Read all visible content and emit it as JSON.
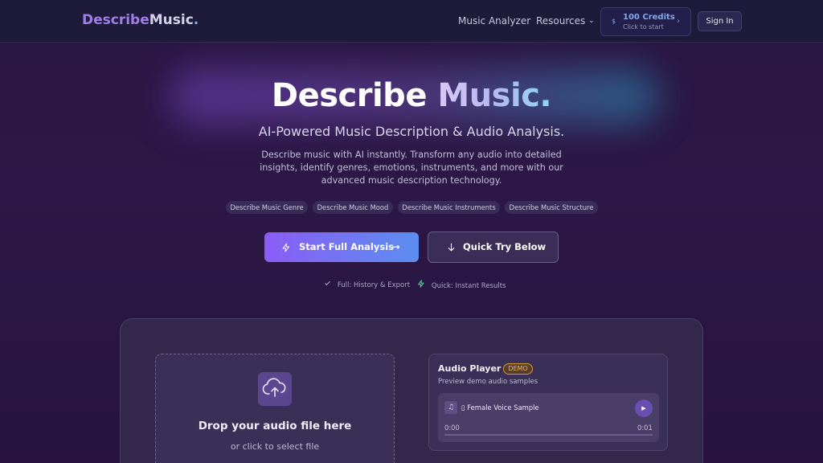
{
  "header": {
    "logo": {
      "part1": "Describe",
      "part2": "Music",
      "part3": "."
    },
    "nav": [
      {
        "label": "Music Analyzer"
      },
      {
        "label": "Resources",
        "chevron": "⌄"
      }
    ],
    "credits": {
      "icon": "$",
      "amount": "100 Credits",
      "sub": "Click to start",
      "chevron": "›"
    },
    "sign_in": "Sign In"
  },
  "hero": {
    "title_part1": "Describe",
    "title_part2": "Music.",
    "subtitle": "AI-Powered Music Description & Audio Analysis.",
    "description": "Describe music with AI instantly. Transform any audio into detailed insights, identify genres, emotions, instruments, and more with our advanced music description technology.",
    "tags": [
      "Describe Music Genre",
      "Describe Music Mood",
      "Describe Music Instruments",
      "Describe Music Structure"
    ],
    "primary_button": {
      "icon": "lightning-icon",
      "label": "Start Full Analysis",
      "arrow": "→"
    },
    "secondary_button": {
      "icon": "arrow-down-icon",
      "label": "Quick Try Below"
    },
    "features": [
      {
        "icon": "check-icon",
        "label": "Full: History & Export"
      },
      {
        "icon": "lightning-icon",
        "label": "Quick: Instant Results"
      }
    ]
  },
  "upload": {
    "icon": "cloud-upload-icon",
    "title": "Drop your audio file here",
    "subtitle": "or click to select file"
  },
  "player": {
    "title": "Audio Player",
    "badge": "DEMO",
    "subtitle": "Preview demo audio samples",
    "track": {
      "icon": "music-note-icon",
      "name": "▯ Female Voice Sample",
      "time_current": "0:00",
      "time_total": "0:01",
      "progress": 0
    }
  },
  "colors": {
    "accent": "#8b5cf6",
    "accent2": "#5b8ef0",
    "badge": "#f2b84a",
    "background": "#2a1642"
  }
}
